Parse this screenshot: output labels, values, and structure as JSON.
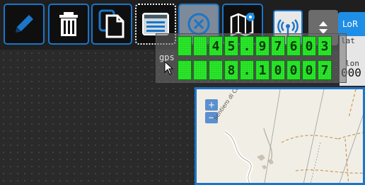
{
  "toolbar": {
    "buttons": [
      {
        "icon": "pencil-icon"
      },
      {
        "icon": "trash-icon"
      },
      {
        "icon": "copy-icon"
      },
      {
        "icon": "widget-panel-icon"
      },
      {
        "icon": "close-circle-icon"
      },
      {
        "icon": "map-marker-icon"
      },
      {
        "icon": "radio-tower-icon"
      },
      {
        "icon": "up-down-arrows-icon"
      }
    ],
    "lora_label": "LoR"
  },
  "gps_widget": {
    "label": "gps",
    "latitude_digits": [
      " ",
      " ",
      "4",
      "5",
      ".",
      "9",
      "7",
      "6",
      "0",
      "3"
    ],
    "longitude_digits": [
      " ",
      " ",
      " ",
      "8",
      ".",
      "1",
      "0",
      "0",
      "0",
      "7"
    ]
  },
  "lora_panel": {
    "lat_label": "lat",
    "lon_label": "lon",
    "lon_value": "000"
  },
  "map": {
    "zoom_in": "+",
    "zoom_out": "−",
    "place_label": "Sentiero di Conna"
  },
  "colors": {
    "accent": "#1b75c9",
    "digit_green": "#2aed2a",
    "lora_blue": "#1f8ee6"
  }
}
